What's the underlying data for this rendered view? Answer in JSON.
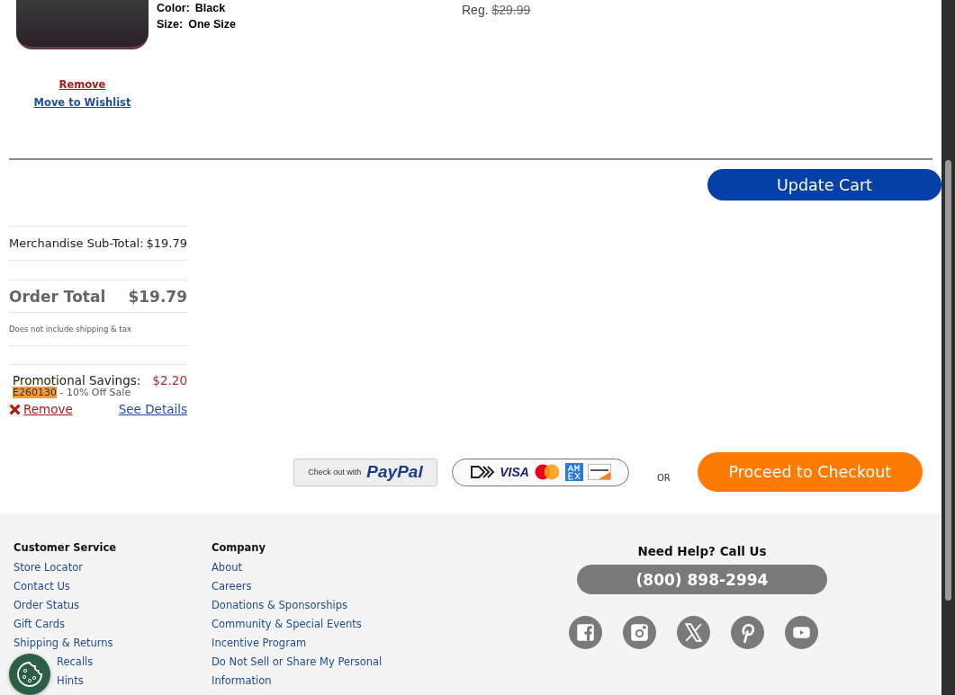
{
  "product": {
    "attributes": [
      {
        "label": "Color:",
        "value": "Black"
      },
      {
        "label": "Size:",
        "value": "One Size"
      }
    ],
    "reg_label": "Reg.",
    "reg_price": "$29.99",
    "remove": "Remove",
    "wishlist": "Move to Wishlist"
  },
  "update_button": "Update Cart",
  "summary": {
    "subtotal_label": "Merchandise Sub-Total:",
    "subtotal": "$19.79",
    "total_label": "Order Total",
    "total": "$19.79",
    "note": "Does not include shipping & tax",
    "promo": {
      "label": "Promotional Savings:",
      "amount": "$2.20",
      "code": "E260130",
      "description": "- 10% Off Sale",
      "remove": "Remove",
      "details": "See Details"
    }
  },
  "checkout": {
    "paypal_prefix": "Check out with",
    "paypal_brand": "PayPal",
    "card_brand": "VISA",
    "or": "OR",
    "proceed": "Proceed to Checkout"
  },
  "footer": {
    "columns": [
      {
        "heading": "Customer Service",
        "links": [
          "Store Locator",
          "Contact Us",
          "Order Status",
          "Gift Cards",
          "Shipping & Returns",
          "Recalls",
          "Hints"
        ]
      },
      {
        "heading": "Company",
        "links": [
          "About",
          "Careers",
          "Donations & Sponsorships",
          "Community & Special Events",
          "Incentive Program",
          "Do Not Sell or Share My Personal",
          "Information"
        ]
      }
    ],
    "help_heading": "Need Help? Call Us",
    "phone": "(800) 898-2994"
  }
}
